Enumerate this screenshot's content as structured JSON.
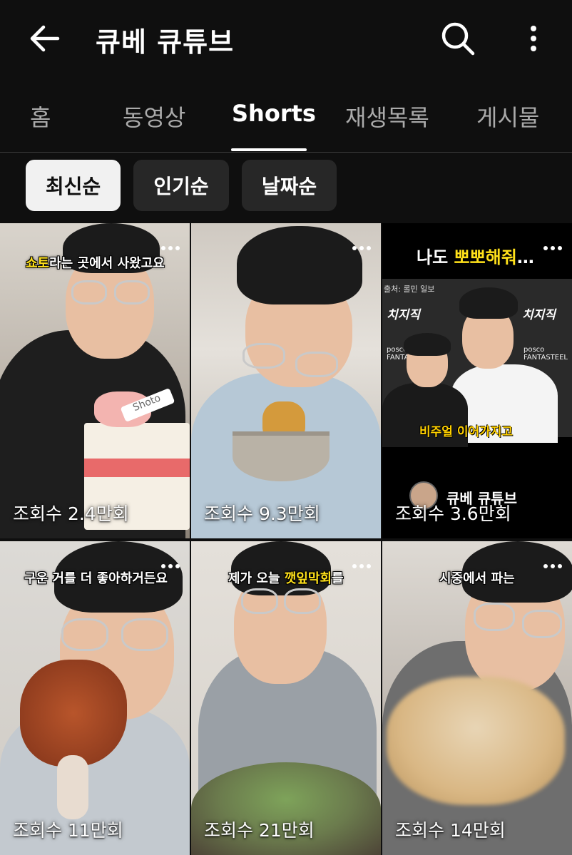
{
  "header": {
    "title": "큐베 큐튜브"
  },
  "tabs": [
    {
      "label": "홈"
    },
    {
      "label": "동영상"
    },
    {
      "label": "Shorts"
    },
    {
      "label": "재생목록"
    },
    {
      "label": "게시물"
    }
  ],
  "active_tab": "Shorts",
  "chips": [
    {
      "label": "최신순"
    },
    {
      "label": "인기순"
    },
    {
      "label": "날짜순"
    }
  ],
  "active_chip": "최신순",
  "shorts": [
    {
      "views": "조회수 2.4만회",
      "caption_pre": "",
      "caption_hl": "쇼토",
      "caption_post": "라는 곳에서 사왔고요",
      "cake_label": "Shoto"
    },
    {
      "views": "조회수 9.3만회"
    },
    {
      "views": "조회수 3.6만회",
      "headline_pre": "나도 ",
      "headline_hl": "뽀뽀해줘",
      "headline_post": "…",
      "source": "출처: 롤민 일보",
      "logo_left": "치지직",
      "logo_right": "치지직",
      "sponsor": "posco FANTASTEEL",
      "subtitle": "비주얼 이어가지고",
      "channel_tag": "큐베 큐튜브"
    },
    {
      "views": "조회수 11만회",
      "caption_pre": "구운 거를 더 좋아하거든요",
      "caption_hl": "",
      "caption_post": ""
    },
    {
      "views": "조회수 21만회",
      "caption_pre": "제가 오늘 ",
      "caption_hl": "깻잎막회",
      "caption_post": "를"
    },
    {
      "views": "조회수 14만회",
      "caption_pre": "시중에서 파는",
      "caption_hl": "",
      "caption_post": ""
    }
  ],
  "colors": {
    "background": "#0f0f0f",
    "chip_active": "#f1f1f1",
    "chip": "#272727",
    "caption_highlight": "#ffe11a"
  },
  "icons": [
    "back-arrow-icon",
    "search-icon",
    "more-vert-icon",
    "more-horiz-icon"
  ]
}
